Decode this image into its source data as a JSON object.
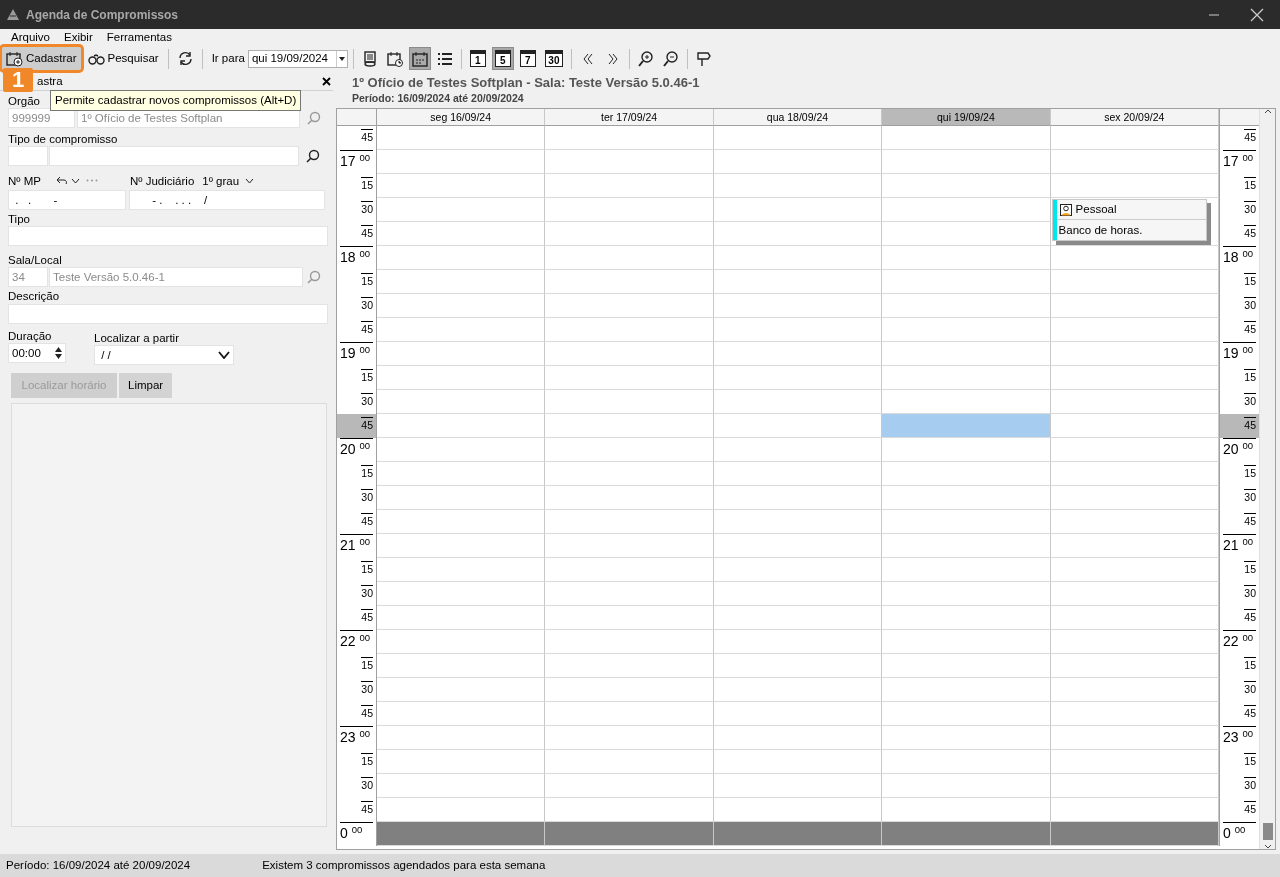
{
  "window": {
    "title": "Agenda de Compromissos"
  },
  "menu": [
    {
      "label": "Arquivo"
    },
    {
      "label": "Exibir"
    },
    {
      "label": "Ferramentas"
    }
  ],
  "toolbar": {
    "new_button": {
      "label": "Cadastrar",
      "highlighted": true
    },
    "search_button": {
      "label": "Pesquisar"
    },
    "goto_label": "Ir para",
    "goto_date": "qui 19/09/2024",
    "views": [
      {
        "kind": "grid",
        "selected": true
      },
      {
        "kind": "list",
        "selected": false
      }
    ],
    "ranges": [
      {
        "label": "1",
        "selected": false
      },
      {
        "label": "5",
        "selected": true
      },
      {
        "label": "7",
        "selected": false
      },
      {
        "label": "30",
        "selected": false
      }
    ]
  },
  "callout": {
    "number": "1"
  },
  "tooltip": "Permite cadastrar novos compromissos (Alt+D)",
  "form": {
    "title": "astra",
    "orgao": {
      "label": "Orgão",
      "code": "999999",
      "name": "1º Ofício de Testes Softplan"
    },
    "tipo_compromisso": {
      "label": "Tipo de compromisso"
    },
    "mp": {
      "label": "Nº MP",
      "value": " .   .       -"
    },
    "judiciario": {
      "label": "Nº Judiciário",
      "grade": "1º grau",
      "value": "      - .    . . .    /"
    },
    "tipo": {
      "label": "Tipo"
    },
    "sala": {
      "label": "Sala/Local",
      "code": "34",
      "name": "Teste Versão 5.0.46-1"
    },
    "descricao": {
      "label": "Descrição"
    },
    "duracao": {
      "label": "Duração",
      "value": "00:00"
    },
    "localizar": {
      "label": "Localizar a partir",
      "value": " / /"
    },
    "buttons": [
      {
        "label": "Localizar horário",
        "disabled": true
      },
      {
        "label": "Limpar",
        "disabled": false
      }
    ]
  },
  "heading": {
    "title": "1º Ofício de Testes Softplan - Sala: Teste Versão 5.0.46-1",
    "period": "Período: 16/09/2024 até 20/09/2024"
  },
  "calendar": {
    "days": [
      {
        "label": "seg 16/09/24",
        "selected": false
      },
      {
        "label": "ter 17/09/24",
        "selected": false
      },
      {
        "label": "qua 18/09/24",
        "selected": false
      },
      {
        "label": "qui 19/09/24",
        "selected": true
      },
      {
        "label": "sex 20/09/24",
        "selected": false
      }
    ],
    "rows": [
      {
        "left": {
          "minute": "45"
        },
        "right": {
          "minute": "45"
        },
        "shaded": false,
        "slots": [
          {
            "selected": false
          },
          {
            "selected": false
          },
          {
            "selected": false
          },
          {
            "selected": false
          },
          {
            "selected": false
          }
        ]
      },
      {
        "left": {
          "hour": "17",
          "minute": "00"
        },
        "right": {
          "hour": "17",
          "minute": "00"
        },
        "shaded": false,
        "slots": [
          {
            "selected": false
          },
          {
            "selected": false
          },
          {
            "selected": false
          },
          {
            "selected": false
          },
          {
            "selected": false
          }
        ]
      },
      {
        "left": {
          "minute": "15"
        },
        "right": {
          "minute": "15"
        },
        "shaded": false,
        "slots": [
          {
            "selected": false
          },
          {
            "selected": false
          },
          {
            "selected": false
          },
          {
            "selected": false
          },
          {
            "selected": false
          }
        ]
      },
      {
        "left": {
          "minute": "30"
        },
        "right": {
          "minute": "30"
        },
        "shaded": false,
        "slots": [
          {
            "selected": false
          },
          {
            "selected": false
          },
          {
            "selected": false
          },
          {
            "selected": false
          },
          {
            "selected": false,
            "appointment": {
              "category": "Pessoal",
              "text": "Banco de horas.",
              "color": "#00e5ee"
            }
          }
        ]
      },
      {
        "left": {
          "minute": "45"
        },
        "right": {
          "minute": "45"
        },
        "shaded": false,
        "slots": [
          {
            "selected": false
          },
          {
            "selected": false
          },
          {
            "selected": false
          },
          {
            "selected": false
          }
        ]
      },
      {
        "left": {
          "hour": "18",
          "minute": "00"
        },
        "right": {
          "hour": "18",
          "minute": "00"
        },
        "shaded": false,
        "slots": [
          {
            "selected": false
          },
          {
            "selected": false
          },
          {
            "selected": false
          },
          {
            "selected": false
          },
          {
            "selected": false
          }
        ]
      },
      {
        "left": {
          "minute": "15"
        },
        "right": {
          "minute": "15"
        },
        "shaded": false,
        "slots": [
          {
            "selected": false
          },
          {
            "selected": false
          },
          {
            "selected": false
          },
          {
            "selected": false
          },
          {
            "selected": false
          }
        ]
      },
      {
        "left": {
          "minute": "30"
        },
        "right": {
          "minute": "30"
        },
        "shaded": false,
        "slots": [
          {
            "selected": false
          },
          {
            "selected": false
          },
          {
            "selected": false
          },
          {
            "selected": false
          },
          {
            "selected": false
          }
        ]
      },
      {
        "left": {
          "minute": "45"
        },
        "right": {
          "minute": "45"
        },
        "shaded": false,
        "slots": [
          {
            "selected": false
          },
          {
            "selected": false
          },
          {
            "selected": false
          },
          {
            "selected": false
          },
          {
            "selected": false
          }
        ]
      },
      {
        "left": {
          "hour": "19",
          "minute": "00"
        },
        "right": {
          "hour": "19",
          "minute": "00"
        },
        "shaded": false,
        "slots": [
          {
            "selected": false
          },
          {
            "selected": false
          },
          {
            "selected": false
          },
          {
            "selected": false
          },
          {
            "selected": false
          }
        ]
      },
      {
        "left": {
          "minute": "15"
        },
        "right": {
          "minute": "15"
        },
        "shaded": false,
        "slots": [
          {
            "selected": false
          },
          {
            "selected": false
          },
          {
            "selected": false
          },
          {
            "selected": false
          },
          {
            "selected": false
          }
        ]
      },
      {
        "left": {
          "minute": "30"
        },
        "right": {
          "minute": "30"
        },
        "shaded": false,
        "slots": [
          {
            "selected": false
          },
          {
            "selected": false
          },
          {
            "selected": false
          },
          {
            "selected": false
          },
          {
            "selected": false
          }
        ]
      },
      {
        "left": {
          "minute": "45"
        },
        "right": {
          "minute": "45"
        },
        "shaded": false,
        "slots": [
          {
            "selected": false
          },
          {
            "selected": false
          },
          {
            "selected": false
          },
          {
            "selected": true
          },
          {
            "selected": false
          }
        ]
      },
      {
        "left": {
          "hour": "20",
          "minute": "00"
        },
        "right": {
          "hour": "20",
          "minute": "00"
        },
        "shaded": false,
        "slots": [
          {
            "selected": false
          },
          {
            "selected": false
          },
          {
            "selected": false
          },
          {
            "selected": false
          },
          {
            "selected": false
          }
        ]
      },
      {
        "left": {
          "minute": "15"
        },
        "right": {
          "minute": "15"
        },
        "shaded": false,
        "slots": [
          {
            "selected": false
          },
          {
            "selected": false
          },
          {
            "selected": false
          },
          {
            "selected": false
          },
          {
            "selected": false
          }
        ]
      },
      {
        "left": {
          "minute": "30"
        },
        "right": {
          "minute": "30"
        },
        "shaded": false,
        "slots": [
          {
            "selected": false
          },
          {
            "selected": false
          },
          {
            "selected": false
          },
          {
            "selected": false
          },
          {
            "selected": false
          }
        ]
      },
      {
        "left": {
          "minute": "45"
        },
        "right": {
          "minute": "45"
        },
        "shaded": false,
        "slots": [
          {
            "selected": false
          },
          {
            "selected": false
          },
          {
            "selected": false
          },
          {
            "selected": false
          },
          {
            "selected": false
          }
        ]
      },
      {
        "left": {
          "hour": "21",
          "minute": "00"
        },
        "right": {
          "hour": "21",
          "minute": "00"
        },
        "shaded": false,
        "slots": [
          {
            "selected": false
          },
          {
            "selected": false
          },
          {
            "selected": false
          },
          {
            "selected": false
          },
          {
            "selected": false
          }
        ]
      },
      {
        "left": {
          "minute": "15"
        },
        "right": {
          "minute": "15"
        },
        "shaded": false,
        "slots": [
          {
            "selected": false
          },
          {
            "selected": false
          },
          {
            "selected": false
          },
          {
            "selected": false
          },
          {
            "selected": false
          }
        ]
      },
      {
        "left": {
          "minute": "30"
        },
        "right": {
          "minute": "30"
        },
        "shaded": false,
        "slots": [
          {
            "selected": false
          },
          {
            "selected": false
          },
          {
            "selected": false
          },
          {
            "selected": false
          },
          {
            "selected": false
          }
        ]
      },
      {
        "left": {
          "minute": "45"
        },
        "right": {
          "minute": "45"
        },
        "shaded": false,
        "slots": [
          {
            "selected": false
          },
          {
            "selected": false
          },
          {
            "selected": false
          },
          {
            "selected": false
          },
          {
            "selected": false
          }
        ]
      },
      {
        "left": {
          "hour": "22",
          "minute": "00"
        },
        "right": {
          "hour": "22",
          "minute": "00"
        },
        "shaded": false,
        "slots": [
          {
            "selected": false
          },
          {
            "selected": false
          },
          {
            "selected": false
          },
          {
            "selected": false
          },
          {
            "selected": false
          }
        ]
      },
      {
        "left": {
          "minute": "15"
        },
        "right": {
          "minute": "15"
        },
        "shaded": false,
        "slots": [
          {
            "selected": false
          },
          {
            "selected": false
          },
          {
            "selected": false
          },
          {
            "selected": false
          },
          {
            "selected": false
          }
        ]
      },
      {
        "left": {
          "minute": "30"
        },
        "right": {
          "minute": "30"
        },
        "shaded": false,
        "slots": [
          {
            "selected": false
          },
          {
            "selected": false
          },
          {
            "selected": false
          },
          {
            "selected": false
          },
          {
            "selected": false
          }
        ]
      },
      {
        "left": {
          "minute": "45"
        },
        "right": {
          "minute": "45"
        },
        "shaded": false,
        "slots": [
          {
            "selected": false
          },
          {
            "selected": false
          },
          {
            "selected": false
          },
          {
            "selected": false
          },
          {
            "selected": false
          }
        ]
      },
      {
        "left": {
          "hour": "23",
          "minute": "00"
        },
        "right": {
          "hour": "23",
          "minute": "00"
        },
        "shaded": false,
        "slots": [
          {
            "selected": false
          },
          {
            "selected": false
          },
          {
            "selected": false
          },
          {
            "selected": false
          },
          {
            "selected": false
          }
        ]
      },
      {
        "left": {
          "minute": "15"
        },
        "right": {
          "minute": "15"
        },
        "shaded": false,
        "slots": [
          {
            "selected": false
          },
          {
            "selected": false
          },
          {
            "selected": false
          },
          {
            "selected": false
          },
          {
            "selected": false
          }
        ]
      },
      {
        "left": {
          "minute": "30"
        },
        "right": {
          "minute": "30"
        },
        "shaded": false,
        "slots": [
          {
            "selected": false
          },
          {
            "selected": false
          },
          {
            "selected": false
          },
          {
            "selected": false
          },
          {
            "selected": false
          }
        ]
      },
      {
        "left": {
          "minute": "45"
        },
        "right": {
          "minute": "45"
        },
        "shaded": false,
        "slots": [
          {
            "selected": false
          },
          {
            "selected": false
          },
          {
            "selected": false
          },
          {
            "selected": false
          },
          {
            "selected": false
          }
        ]
      },
      {
        "left": {
          "hour": "0",
          "minute": "00"
        },
        "right": {
          "hour": "0",
          "minute": "00"
        },
        "shaded": true,
        "slots": [
          {
            "selected": false
          },
          {
            "selected": false
          },
          {
            "selected": false
          },
          {
            "selected": false
          },
          {
            "selected": false
          }
        ]
      }
    ]
  },
  "status_bar": {
    "period": "Período: 16/09/2024 até 20/09/2024",
    "message": "Existem 3 compromissos agendados para esta semana"
  }
}
